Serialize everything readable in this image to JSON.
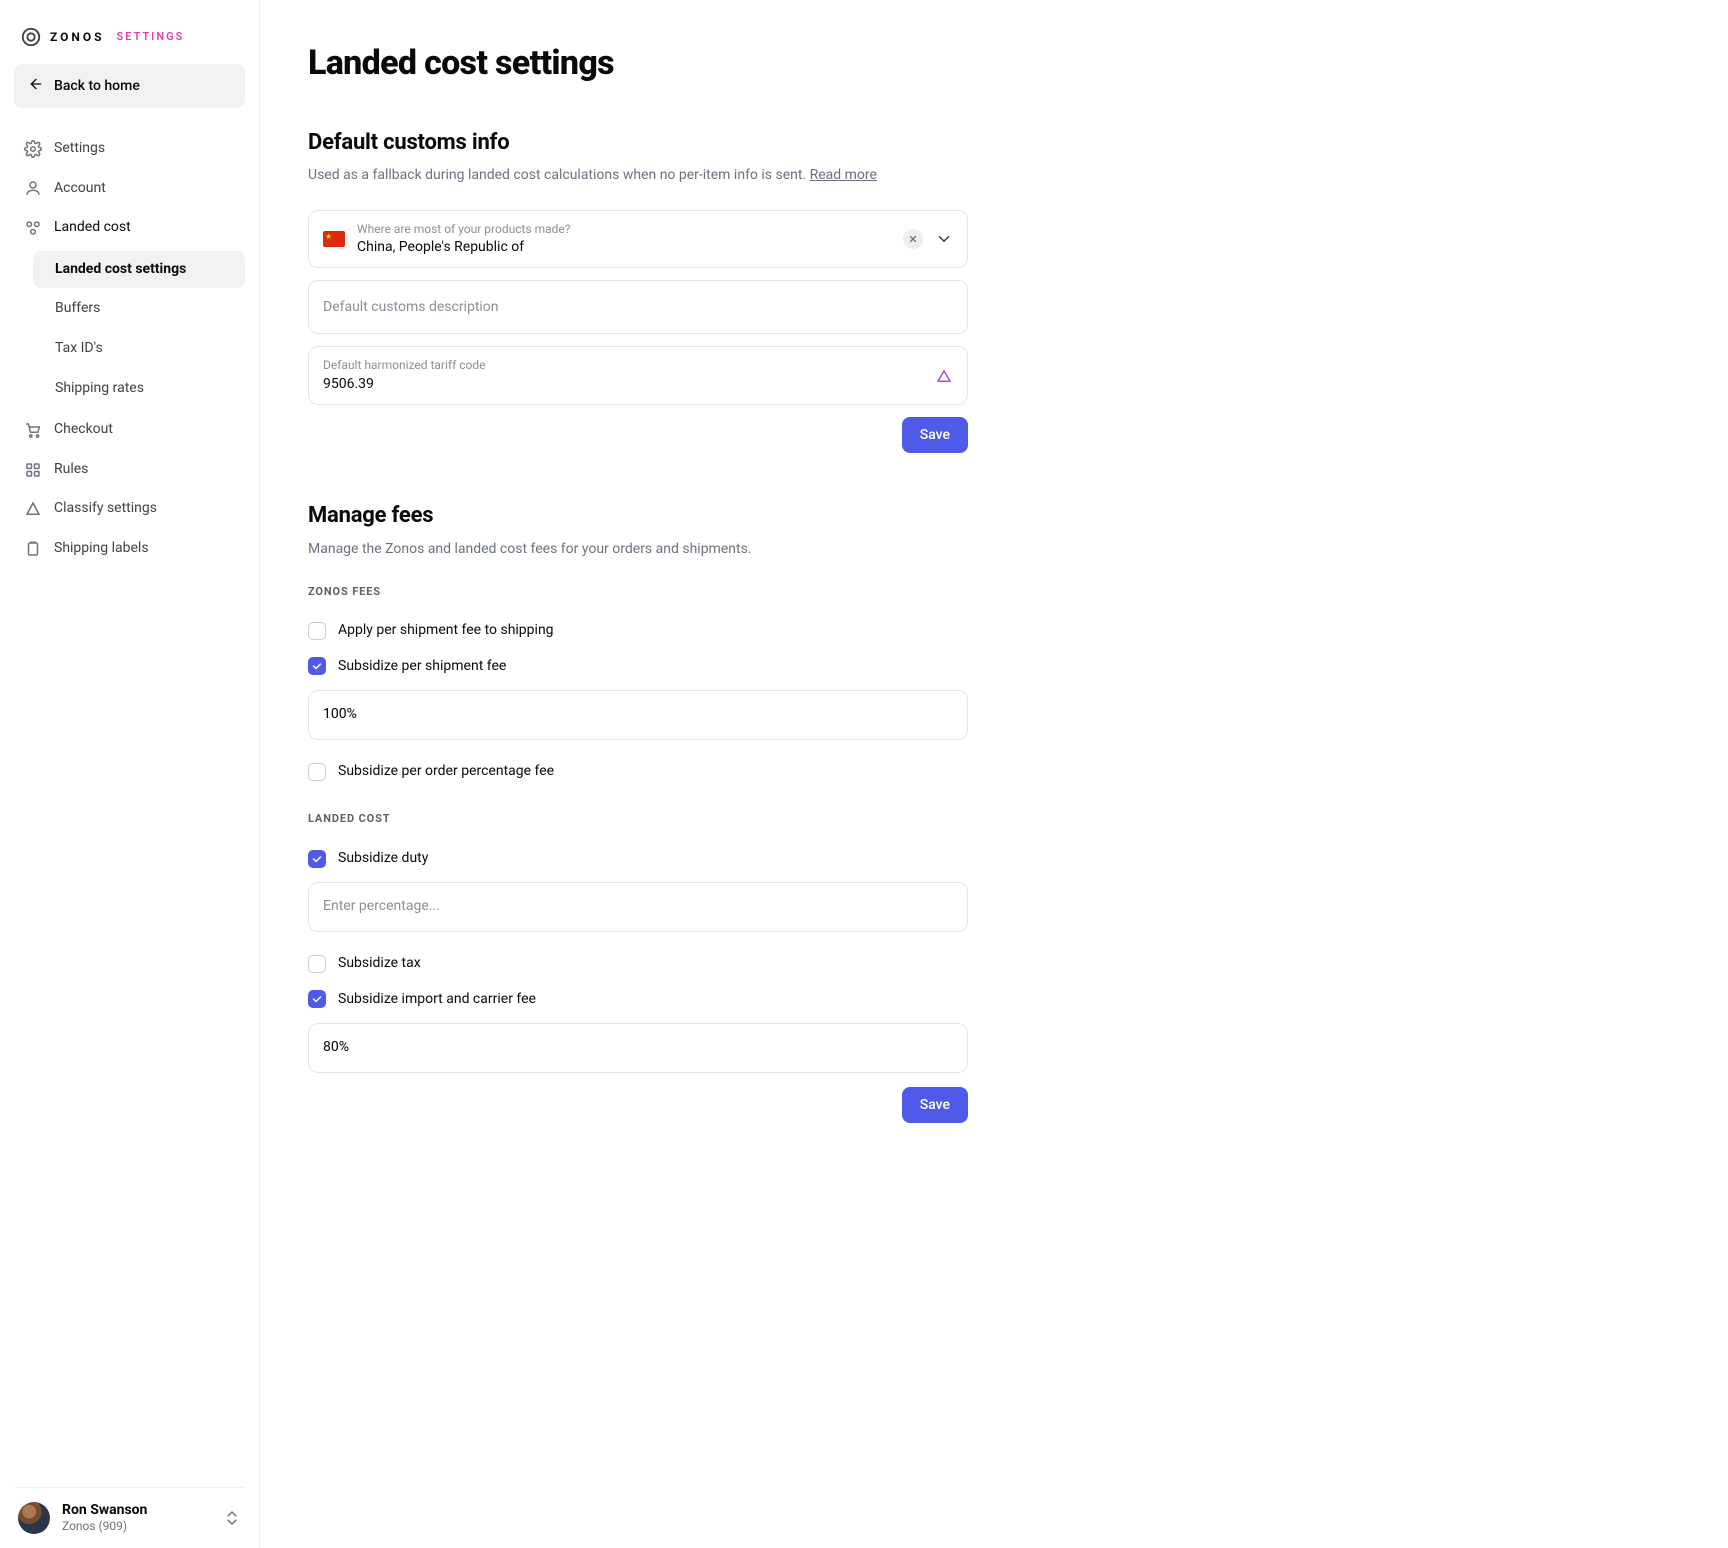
{
  "brand": {
    "name": "ZONOS",
    "section": "SETTINGS"
  },
  "sidebar": {
    "back_label": "Back to home",
    "items": [
      {
        "label": "Settings"
      },
      {
        "label": "Account"
      },
      {
        "label": "Landed cost"
      },
      {
        "label": "Checkout"
      },
      {
        "label": "Rules"
      },
      {
        "label": "Classify settings"
      },
      {
        "label": "Shipping labels"
      }
    ],
    "landed_sub": [
      {
        "label": "Landed cost settings"
      },
      {
        "label": "Buffers"
      },
      {
        "label": "Tax ID's"
      },
      {
        "label": "Shipping rates"
      }
    ]
  },
  "user": {
    "name": "Ron Swanson",
    "org": "Zonos (909)"
  },
  "page": {
    "title": "Landed cost settings",
    "customs": {
      "heading": "Default customs info",
      "desc_prefix": "Used as a fallback during landed cost calculations when no per-item info is sent. ",
      "read_more": "Read more",
      "origin_label": "Where are most of your products made?",
      "origin_value": "China, People's Republic of",
      "description_placeholder": "Default customs description",
      "tariff_label": "Default harmonized tariff code",
      "tariff_value": "9506.39",
      "save": "Save"
    },
    "fees": {
      "heading": "Manage fees",
      "desc": "Manage the Zonos and landed cost fees for your orders and shipments.",
      "zonos_header": "ZONOS FEES",
      "apply_per_shipment": "Apply per shipment fee to shipping",
      "subsidize_per_shipment": "Subsidize per shipment fee",
      "per_shipment_value": "100%",
      "subsidize_per_order": "Subsidize per order percentage fee",
      "landed_header": "LANDED COST",
      "subsidize_duty": "Subsidize duty",
      "duty_placeholder": "Enter percentage...",
      "subsidize_tax": "Subsidize tax",
      "subsidize_import": "Subsidize import and carrier fee",
      "import_value": "80%",
      "save": "Save"
    }
  }
}
